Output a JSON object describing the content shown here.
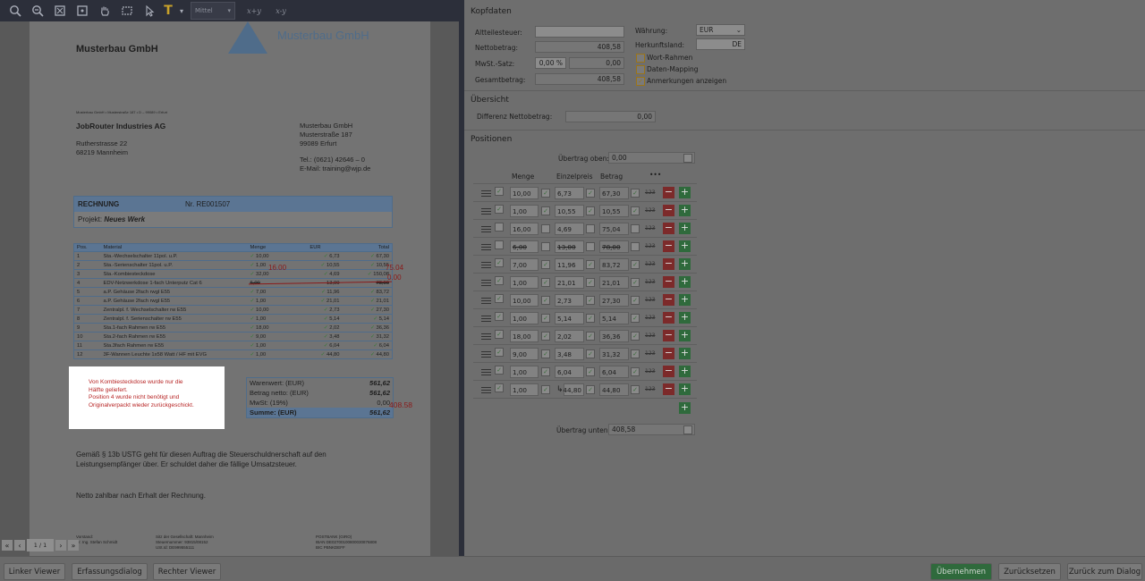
{
  "toolbar": {
    "zoom_label": "Mittel",
    "fx1": "x+y",
    "fx2": "x-y"
  },
  "document": {
    "logo_text": "Musterbau GmbH",
    "company": "Musterbau GmbH",
    "sender_line": "Musterbau GmbH • Musterstraße 187 • D – 99089 • Erfurt",
    "recipient": [
      "JobRouter Industries AG",
      "",
      "Rutherstrasse 22",
      "68219 Mannheim"
    ],
    "sender_block": [
      "Musterbau GmbH",
      "Musterstraße 187",
      "99089 Erfurt",
      "",
      "Tel.: (0621) 42646 – 0",
      "E-Mail: training@wjp.de"
    ],
    "rechnung_label": "RECHNUNG",
    "rechnung_nr": "Nr. RE001507",
    "projekt_label": "Projekt:",
    "projekt_value": "Neues Werk",
    "table_headers": [
      "Pos.",
      "Material",
      "Menge",
      "EUR",
      "Total"
    ],
    "rows": [
      [
        "1",
        "Sta.-Wechselschalter 11pol. u.P.",
        "10,00",
        "6,73",
        "67,30"
      ],
      [
        "2",
        "Sta.-Serienschalter 11pol. u.P.",
        "1,00",
        "10,55",
        "10,55"
      ],
      [
        "3",
        "Sta.-Kombiesteckdose",
        "32,00",
        "4,69",
        "150,08"
      ],
      [
        "4",
        "EDV-Netzwerkdose 1-fach Unterputz Cat 6",
        "6,00",
        "13,00",
        "78,00"
      ],
      [
        "5",
        "a.P. Gehäuse 2fach rwgl E55",
        "7,00",
        "11,96",
        "83,72"
      ],
      [
        "6",
        "a.P. Gehäuse 2fach rwgl E55",
        "1,00",
        "21,01",
        "21,01"
      ],
      [
        "7",
        "Zentralpl. f. Wechselschalter rw E55",
        "10,00",
        "2,73",
        "27,30"
      ],
      [
        "8",
        "Zentralpl. f. Serienschalter rw E55",
        "1,00",
        "5,14",
        "5,14"
      ],
      [
        "9",
        "Sta.1-fach Rahmen rw E55",
        "18,00",
        "2,02",
        "36,36"
      ],
      [
        "10",
        "Sta.2-fach Rahmen rw E55",
        "9,00",
        "3,48",
        "31,32"
      ],
      [
        "11",
        "Sta.3fach Rahmen rw E55",
        "1,00",
        "6,04",
        "6,04"
      ],
      [
        "12",
        "3F-Wannen Leuchte 1x58 Watt / HF mit EVG",
        "1,00",
        "44,80",
        "44,80"
      ]
    ],
    "annot_1600": "16.00",
    "annot_7504": "75.04",
    "annot_000": "0.00",
    "annot_40858": "408.58",
    "note_lines": [
      "Von Kombiesteckdose wurde nur die",
      "Hälfte geliefert.",
      "Position 4 wurde nicht benötigt und",
      "Originalverpackt wieder zurückgeschickt."
    ],
    "sums": [
      [
        "Warenwert: (EUR)",
        "561,62"
      ],
      [
        "Betrag netto: (EUR)",
        "561,62"
      ],
      [
        "MwSt: (19%)",
        "0,00"
      ],
      [
        "Summe: (EUR)",
        "561,62"
      ]
    ],
    "footer_text_1": "Gemäß § 13b USTG geht für diesen Auftrag die Steuerschuldnerschaft auf den",
    "footer_text_2": "Leistungsempfänger über. Er schuldet daher die fällige Umsatzsteuer.",
    "footer_text_3": "Netto zahlbar nach Erhalt der Rechnung.",
    "legal_1": [
      "Vorstand:",
      "Dr. Ing. Stefan Schmidt"
    ],
    "legal_2": [
      "Sitz der Gesellschaft: Mannheim",
      "Steuernummer: 93815/08152",
      "USt.Id: DE999555111"
    ],
    "legal_3": [
      "POSTBANK (GIRO)",
      "IBAN DE02700100800030876808",
      "BIC PBNKDEFF"
    ],
    "page_indicator": "1 / 1"
  },
  "kopfdaten": {
    "title": "Kopfdaten",
    "altteilesteuer_label": "Altteilesteuer:",
    "altteilesteuer_value": "",
    "nettobetrag_label": "Nettobetrag:",
    "nettobetrag_value": "408,58",
    "mwst_label": "MwSt.-Satz:",
    "mwst_pct": "0,00 %",
    "mwst_value": "0,00",
    "gesamt_label": "Gesamtbetrag:",
    "gesamt_value": "408,58",
    "waehrung_label": "Währung:",
    "waehrung_value": "EUR",
    "herkunft_label": "Herkunftsland:",
    "herkunft_value": "DE",
    "chk_wort": "Wort-Rahmen",
    "chk_daten": "Daten-Mapping",
    "chk_anm": "Anmerkungen anzeigen"
  },
  "uebersicht": {
    "title": "Übersicht",
    "diff_label": "Differenz Nettobetrag:",
    "diff_value": "0,00"
  },
  "positionen": {
    "title": "Positionen",
    "uebertrag_oben_label": "Übertrag oben:",
    "uebertrag_oben_value": "0,00",
    "uebertrag_unten_label": "Übertrag unten:",
    "uebertrag_unten_value": "408,58",
    "col_menge": "Menge",
    "col_einzelpreis": "Einzelpreis",
    "col_betrag": "Betrag",
    "col_more": "•••",
    "n123": "123",
    "rows": [
      {
        "menge": "10,00",
        "ep": "6,73",
        "betrag": "67,30",
        "checked": true
      },
      {
        "menge": "1,00",
        "ep": "10,55",
        "betrag": "10,55",
        "checked": true
      },
      {
        "menge": "16,00",
        "ep": "4,69",
        "betrag": "75,04",
        "checked": false
      },
      {
        "menge": "6,00",
        "ep": "13,00",
        "betrag": "78,00",
        "checked": false
      },
      {
        "menge": "7,00",
        "ep": "11,96",
        "betrag": "83,72",
        "checked": true
      },
      {
        "menge": "1,00",
        "ep": "21,01",
        "betrag": "21,01",
        "checked": true
      },
      {
        "menge": "10,00",
        "ep": "2,73",
        "betrag": "27,30",
        "checked": true
      },
      {
        "menge": "1,00",
        "ep": "5,14",
        "betrag": "5,14",
        "checked": true
      },
      {
        "menge": "18,00",
        "ep": "2,02",
        "betrag": "36,36",
        "checked": true
      },
      {
        "menge": "9,00",
        "ep": "3,48",
        "betrag": "31,32",
        "checked": true
      },
      {
        "menge": "1,00",
        "ep": "6,04",
        "betrag": "6,04",
        "checked": true
      },
      {
        "menge": "1,00",
        "ep": "44,80",
        "betrag": "44,80",
        "checked": true
      }
    ]
  },
  "bottom": {
    "linker_viewer": "Linker Viewer",
    "erfassungsdialog": "Erfassungsdialog",
    "rechter_viewer": "Rechter Viewer",
    "uebernehmen": "Übernehmen",
    "zuruecksetzen": "Zurücksetzen",
    "zurueck_dialog": "Zurück zum Dialog"
  },
  "colors": {
    "accent_green": "#2f6a3c",
    "accent_red": "#7c2a2a",
    "brand_blue": "#4f6c8a"
  }
}
